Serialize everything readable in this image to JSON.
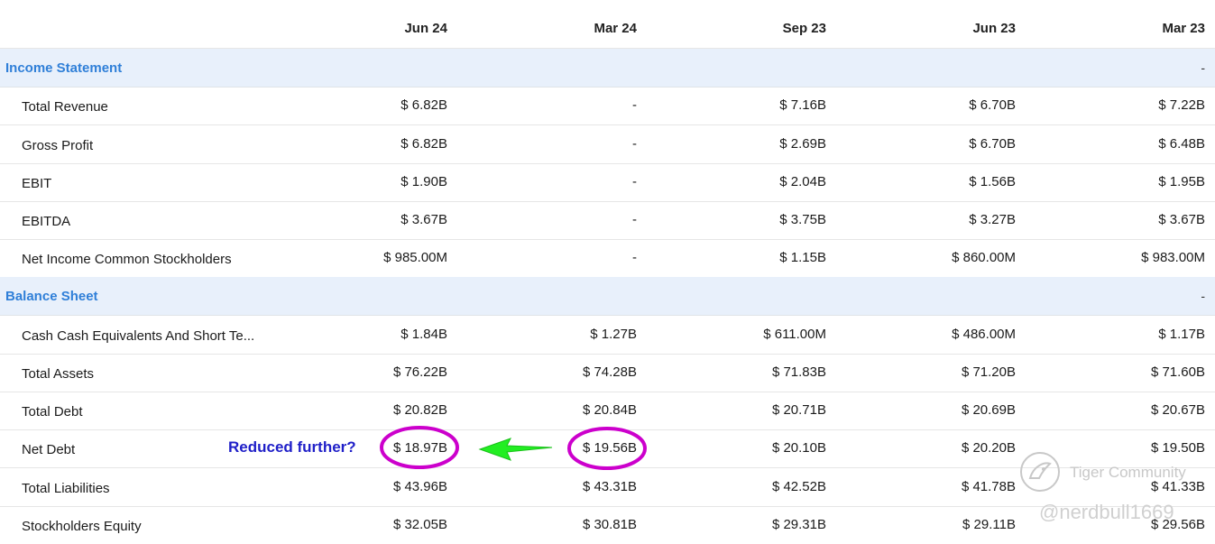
{
  "columns": [
    "Jun 24",
    "Mar 24",
    "Sep 23",
    "Jun 23",
    "Mar 23"
  ],
  "sections": {
    "income": {
      "title": "Income Statement",
      "dash": "-",
      "rows": [
        {
          "label": "Total Revenue",
          "values": [
            "$ 6.82B",
            "-",
            "$ 7.16B",
            "$ 6.70B",
            "$ 7.22B"
          ]
        },
        {
          "label": "Gross Profit",
          "values": [
            "$ 6.82B",
            "-",
            "$ 2.69B",
            "$ 6.70B",
            "$ 6.48B"
          ]
        },
        {
          "label": "EBIT",
          "values": [
            "$ 1.90B",
            "-",
            "$ 2.04B",
            "$ 1.56B",
            "$ 1.95B"
          ]
        },
        {
          "label": "EBITDA",
          "values": [
            "$ 3.67B",
            "-",
            "$ 3.75B",
            "$ 3.27B",
            "$ 3.67B"
          ]
        },
        {
          "label": "Net Income Common Stockholders",
          "values": [
            "$ 985.00M",
            "-",
            "$ 1.15B",
            "$ 860.00M",
            "$ 983.00M"
          ]
        }
      ]
    },
    "balance": {
      "title": "Balance Sheet",
      "dash": "-",
      "rows": [
        {
          "label": "Cash Cash Equivalents And Short Te...",
          "values": [
            "$ 1.84B",
            "$ 1.27B",
            "$ 611.00M",
            "$ 486.00M",
            "$ 1.17B"
          ]
        },
        {
          "label": "Total Assets",
          "values": [
            "$ 76.22B",
            "$ 74.28B",
            "$ 71.83B",
            "$ 71.20B",
            "$ 71.60B"
          ]
        },
        {
          "label": "Total Debt",
          "values": [
            "$ 20.82B",
            "$ 20.84B",
            "$ 20.71B",
            "$ 20.69B",
            "$ 20.67B"
          ]
        },
        {
          "label": "Net Debt",
          "values": [
            "$ 18.97B",
            "$ 19.56B",
            "$ 20.10B",
            "$ 20.20B",
            "$ 19.50B"
          ]
        },
        {
          "label": "Total Liabilities",
          "values": [
            "$ 43.96B",
            "$ 43.31B",
            "$ 42.52B",
            "$ 41.78B",
            "$ 41.33B"
          ]
        },
        {
          "label": "Stockholders Equity",
          "values": [
            "$ 32.05B",
            "$ 30.81B",
            "$ 29.31B",
            "$ 29.11B",
            "$ 29.56B"
          ]
        }
      ]
    }
  },
  "annotation": {
    "text": "Reduced further?",
    "circle_color": "#cc00cc",
    "arrow_color": "#22ee22",
    "text_color": "#1f1fc8"
  },
  "watermark": {
    "brand": "Tiger Community",
    "user": "@nerdbull1669",
    "icon": "tiger-logo-icon"
  },
  "colors": {
    "section_bg": "#e8f0fb",
    "section_title": "#2f7fd8"
  }
}
